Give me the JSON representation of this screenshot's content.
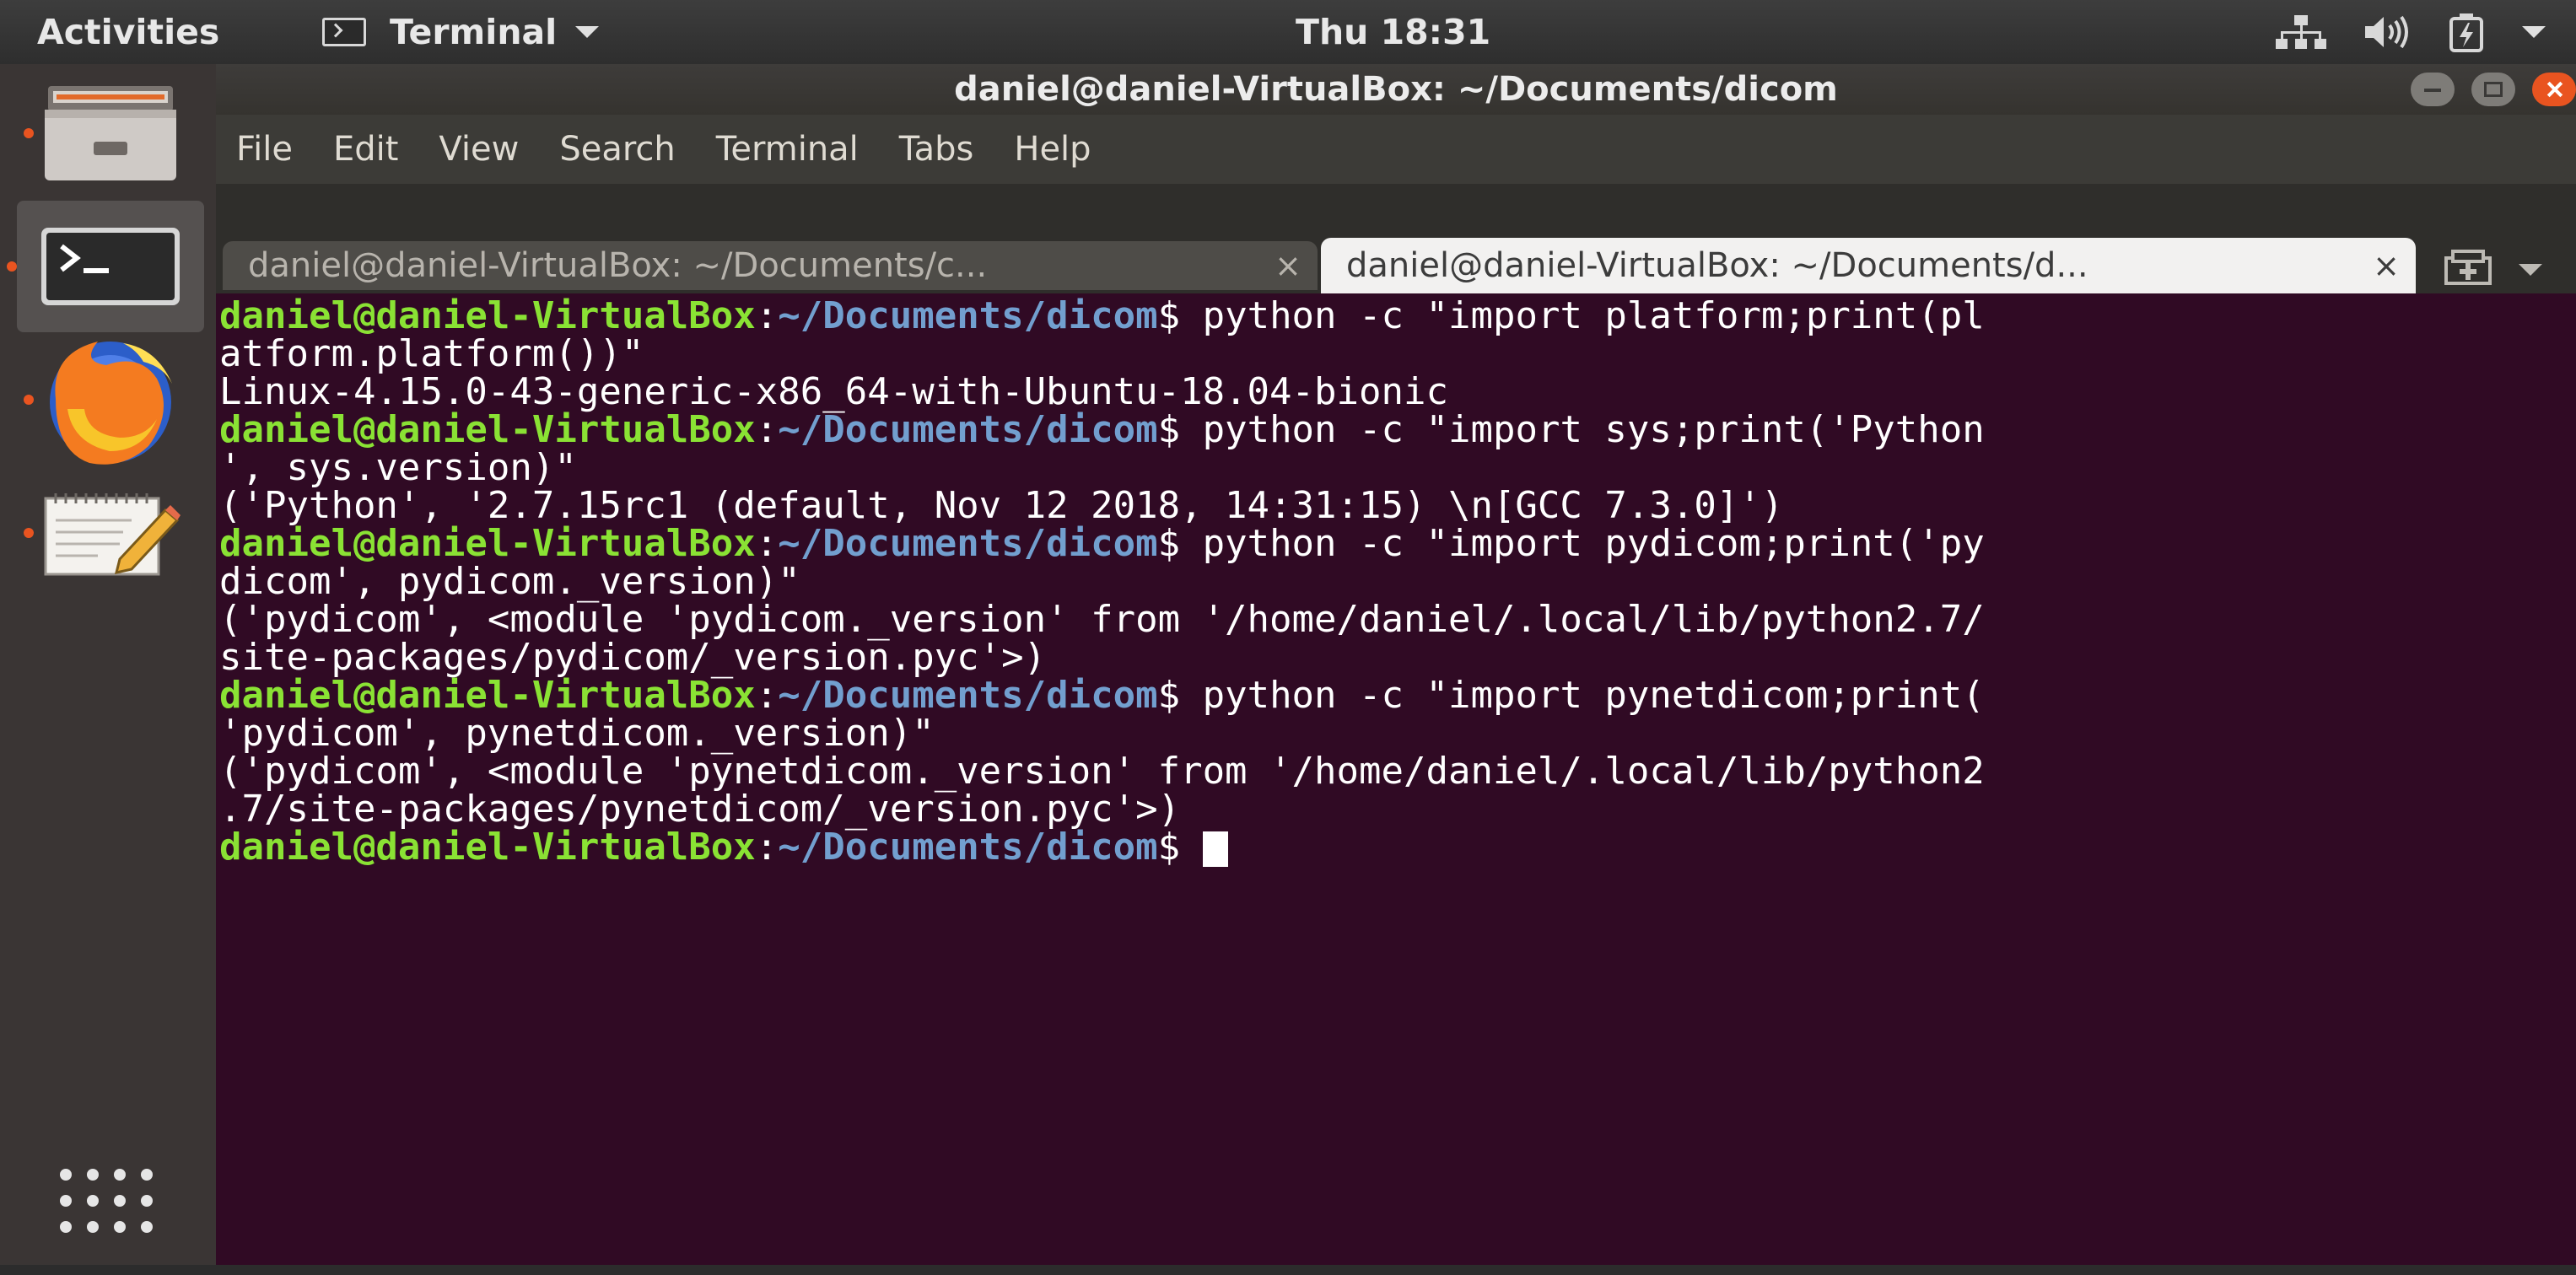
{
  "topbar": {
    "activities": "Activities",
    "app_name": "Terminal",
    "clock": "Thu 18:31",
    "tray_icons": [
      "network-icon",
      "volume-icon",
      "battery-icon",
      "system-menu-caret"
    ]
  },
  "dock": {
    "items": [
      {
        "name": "files-icon",
        "running": true
      },
      {
        "name": "terminal-icon",
        "running": true,
        "active": true
      },
      {
        "name": "firefox-icon",
        "running": true
      },
      {
        "name": "text-editor-icon",
        "running": true
      }
    ],
    "show_apps": "apps-grid-icon"
  },
  "window": {
    "title": "daniel@daniel-VirtualBox: ~/Documents/dicom",
    "menu": [
      "File",
      "Edit",
      "View",
      "Search",
      "Terminal",
      "Tabs",
      "Help"
    ],
    "tabs": [
      {
        "label": "daniel@daniel-VirtualBox: ~/Documents/c...",
        "active": false
      },
      {
        "label": "daniel@daniel-VirtualBox: ~/Documents/d...",
        "active": true
      }
    ],
    "tab_close": "×"
  },
  "terminal": {
    "prompt_user": "daniel@daniel-VirtualBox",
    "prompt_sep": ":",
    "prompt_path": "~/Documents/dicom",
    "prompt_sign": "$ ",
    "lines": [
      {
        "prompt": true,
        "text": "python -c \"import platform;print(pl"
      },
      {
        "prompt": false,
        "text": "atform.platform())\""
      },
      {
        "prompt": false,
        "text": "Linux-4.15.0-43-generic-x86_64-with-Ubuntu-18.04-bionic"
      },
      {
        "prompt": true,
        "text": "python -c \"import sys;print('Python"
      },
      {
        "prompt": false,
        "text": "', sys.version)\""
      },
      {
        "prompt": false,
        "text": "('Python', '2.7.15rc1 (default, Nov 12 2018, 14:31:15) \\n[GCC 7.3.0]')"
      },
      {
        "prompt": true,
        "text": "python -c \"import pydicom;print('py"
      },
      {
        "prompt": false,
        "text": "dicom', pydicom._version)\""
      },
      {
        "prompt": false,
        "text": "('pydicom', <module 'pydicom._version' from '/home/daniel/.local/lib/python2.7/"
      },
      {
        "prompt": false,
        "text": "site-packages/pydicom/_version.pyc'>)"
      },
      {
        "prompt": true,
        "text": "python -c \"import pynetdicom;print("
      },
      {
        "prompt": false,
        "text": "'pydicom', pynetdicom._version)\""
      },
      {
        "prompt": false,
        "text": "('pydicom', <module 'pynetdicom._version' from '/home/daniel/.local/lib/python2"
      },
      {
        "prompt": false,
        "text": ".7/site-packages/pynetdicom/_version.pyc'>)"
      },
      {
        "prompt": true,
        "text": "",
        "cursor": true
      }
    ]
  }
}
